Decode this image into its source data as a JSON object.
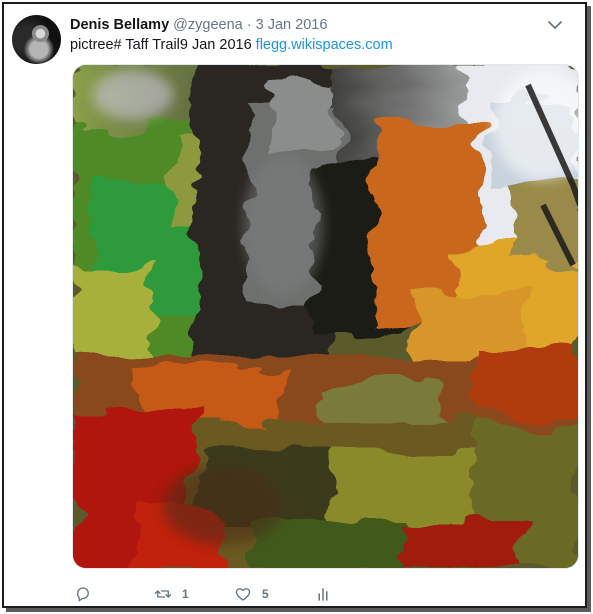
{
  "tweet": {
    "author_name": "Denis Bellamy",
    "author_handle": "@zygeena",
    "separator": "·",
    "date": "3 Jan 2016",
    "text": "pictree# Taff Trail9 Jan 2016",
    "link_text": "flegg.wikispaces.com",
    "media_icon": "painted-forest-image"
  },
  "actions": {
    "reply_count": "",
    "retweet_count": "1",
    "like_count": "5",
    "icons": [
      "reply-icon",
      "retweet-icon",
      "heart-icon",
      "analytics-icon"
    ]
  },
  "colors": {
    "link": "#1b95e0",
    "secondary_text": "#657786",
    "primary_text": "#14171a"
  }
}
